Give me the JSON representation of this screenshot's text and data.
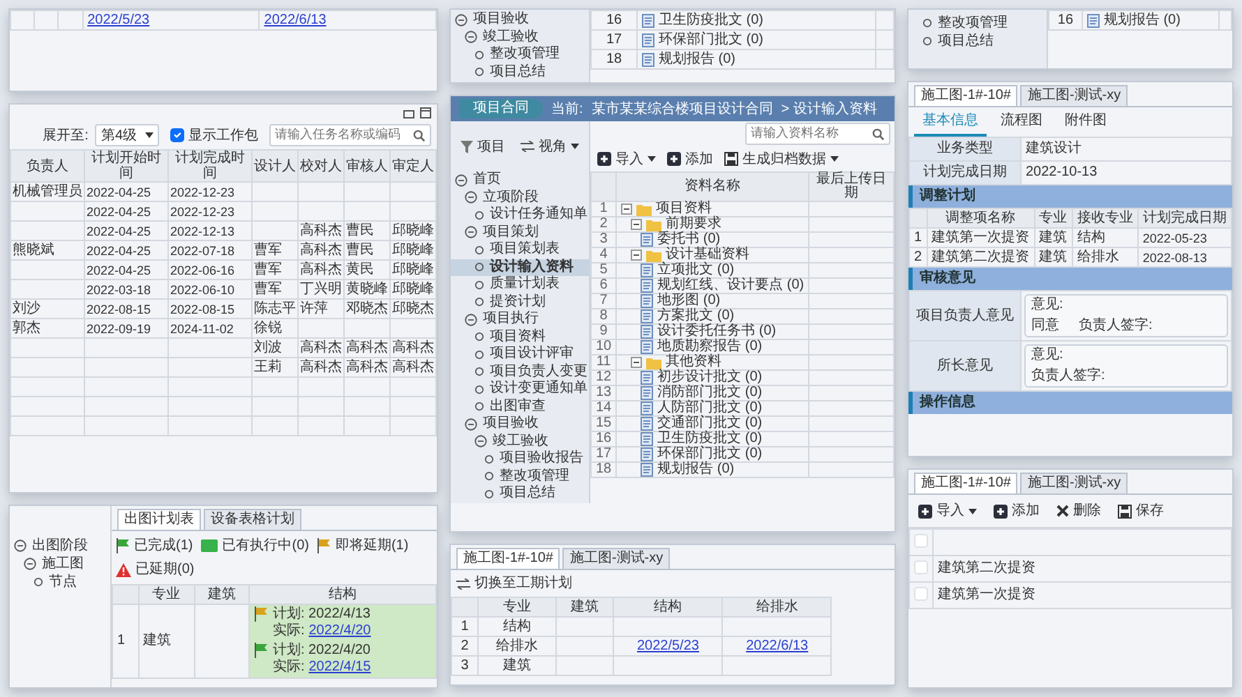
{
  "top_left_fragment": {
    "rows": [
      {
        "cells": [
          {
            "text": "2022/5/23",
            "link": true
          },
          {
            "text": "2022/6/13",
            "link": true
          }
        ]
      }
    ]
  },
  "top_middle_fragment": {
    "nav": [
      {
        "label": "项目验收",
        "expanded": true,
        "children": [
          {
            "label": "竣工验收",
            "expanded": true,
            "children": [
              {
                "label": "整改项管理"
              },
              {
                "label": "项目总结"
              }
            ]
          }
        ]
      }
    ],
    "rows": [
      {
        "no": "16",
        "label": "卫生防疫批文 (0)"
      },
      {
        "no": "17",
        "label": "环保部门批文 (0)"
      },
      {
        "no": "18",
        "label": "规划报告 (0)"
      }
    ]
  },
  "top_right_fragment": {
    "nav": [
      {
        "label": "整改项管理"
      },
      {
        "label": "项目总结"
      }
    ],
    "rows": [
      {
        "no": "16",
        "label": "规划报告 (0)"
      }
    ]
  },
  "schedule_panel": {
    "expand_label": "展开至:",
    "expand_level": "第4级",
    "show_packages": {
      "label": "显示工作包",
      "checked": true
    },
    "search": {
      "placeholder": "请输入任务名称或编码"
    },
    "columns": [
      "负责人",
      "计划开始时间",
      "计划完成时间",
      "设计人",
      "校对人",
      "审核人",
      "审定人"
    ],
    "rows": [
      {
        "cells": [
          "机械管理员",
          "2022-04-25",
          "2022-12-23",
          "",
          "",
          "",
          ""
        ]
      },
      {
        "cells": [
          "",
          "2022-04-25",
          "2022-12-23",
          "",
          "",
          "",
          ""
        ]
      },
      {
        "cells": [
          "",
          "2022-04-25",
          "2022-12-13",
          "",
          "高科杰",
          "曹民",
          "邱晓峰"
        ]
      },
      {
        "cells": [
          "熊晓斌",
          "2022-04-25",
          "2022-07-18",
          "曹军",
          "高科杰",
          "曹民",
          "邱晓峰"
        ]
      },
      {
        "cells": [
          "",
          "2022-04-25",
          "2022-06-16",
          "曹军",
          "高科杰",
          "黄民",
          "邱晓峰"
        ]
      },
      {
        "cells": [
          "",
          "2022-03-18",
          "2022-06-10",
          "曹军",
          "丁兴明",
          "黄晓峰",
          "邱晓峰"
        ]
      },
      {
        "cells": [
          "刘沙",
          "2022-08-15",
          "2022-08-15",
          "陈志平",
          "许萍",
          "邓晓杰",
          "邱晓杰"
        ]
      },
      {
        "cells": [
          "郭杰",
          "2022-09-19",
          "2024-11-02",
          "徐锐",
          "",
          "",
          ""
        ]
      },
      {
        "cells": [
          "",
          "",
          "",
          "刘波",
          "高科杰",
          "高科杰",
          "高科杰"
        ]
      },
      {
        "cells": [
          "",
          "",
          "",
          "王莉",
          "高科杰",
          "高科杰",
          "高科杰"
        ]
      }
    ]
  },
  "main_panel": {
    "module_tab": "项目合同",
    "breadcrumb_label": "当前:",
    "breadcrumb": "某市某某综合楼项目设计合同",
    "breadcrumb_current": "> 设计输入资料",
    "search": {
      "placeholder": "请输入资料名称"
    },
    "nav_header": {
      "title": "项目",
      "view": "视角"
    },
    "nav": [
      {
        "label": "首页",
        "expanded": true,
        "selected": false,
        "children": [
          {
            "label": "立项阶段",
            "expanded": true,
            "selected": false,
            "children": [
              {
                "label": "设计任务通知单",
                "selected": false
              }
            ]
          },
          {
            "label": "项目策划",
            "expanded": true,
            "selected": false,
            "children": [
              {
                "label": "项目策划表",
                "selected": false
              },
              {
                "label": "设计输入资料",
                "selected": true
              },
              {
                "label": "质量计划表",
                "selected": false
              },
              {
                "label": "提资计划",
                "selected": false
              }
            ]
          },
          {
            "label": "项目执行",
            "expanded": true,
            "selected": false,
            "children": [
              {
                "label": "项目资料",
                "selected": false
              },
              {
                "label": "项目设计评审",
                "selected": false
              },
              {
                "label": "项目负责人变更",
                "selected": false
              },
              {
                "label": "设计变更通知单",
                "selected": false
              },
              {
                "label": "出图审查",
                "selected": false
              }
            ]
          },
          {
            "label": "项目验收",
            "expanded": true,
            "selected": false,
            "children": [
              {
                "label": "竣工验收",
                "expanded": true,
                "selected": false,
                "children": [
                  {
                    "label": "项目验收报告",
                    "selected": false
                  },
                  {
                    "label": "整改项管理",
                    "selected": false
                  },
                  {
                    "label": "项目总结",
                    "selected": false
                  }
                ]
              }
            ]
          }
        ]
      }
    ],
    "toolbar": [
      {
        "label": "导入",
        "kind": "import"
      },
      {
        "label": "添加",
        "kind": "add"
      },
      {
        "label": "生成归档数据",
        "kind": "archive"
      }
    ],
    "columns": [
      "资料名称",
      "最后上传日期"
    ],
    "resources": [
      {
        "no": "1",
        "label": "项目资料",
        "expanded": true,
        "children": [
          {
            "no": "2",
            "label": "前期要求",
            "expanded": true,
            "children": [
              {
                "no": "3",
                "label": "委托书 (0)"
              }
            ]
          },
          {
            "no": "4",
            "label": "设计基础资料",
            "expanded": true,
            "children": [
              {
                "no": "5",
                "label": "立项批文 (0)"
              },
              {
                "no": "6",
                "label": "规划红线、设计要点 (0)"
              },
              {
                "no": "7",
                "label": "地形图 (0)"
              },
              {
                "no": "8",
                "label": "方案批文 (0)"
              },
              {
                "no": "9",
                "label": "设计委托任务书 (0)"
              },
              {
                "no": "10",
                "label": "地质勘察报告 (0)"
              }
            ]
          },
          {
            "no": "11",
            "label": "其他资料",
            "expanded": true,
            "children": [
              {
                "no": "12",
                "label": "初步设计批文 (0)"
              },
              {
                "no": "13",
                "label": "消防部门批文 (0)"
              },
              {
                "no": "14",
                "label": "人防部门批文 (0)"
              },
              {
                "no": "15",
                "label": "交通部门批文 (0)"
              },
              {
                "no": "16",
                "label": "卫生防疫批文 (0)"
              },
              {
                "no": "17",
                "label": "环保部门批文 (0)"
              },
              {
                "no": "18",
                "label": "规划报告 (0)"
              }
            ]
          }
        ]
      }
    ]
  },
  "detail_panel": {
    "doc_tabs": [
      {
        "label": "施工图-1#-10#",
        "selected": true
      },
      {
        "label": "施工图-测试-xy",
        "selected": false
      }
    ],
    "view_tabs": [
      {
        "label": "基本信息",
        "selected": true
      },
      {
        "label": "流程图",
        "selected": false
      },
      {
        "label": "附件图",
        "selected": false
      }
    ],
    "fields": [
      {
        "label": "业务类型",
        "value": "建筑设计"
      },
      {
        "label": "计划完成日期",
        "value": "2022-10-13"
      }
    ],
    "plan_section": {
      "title": "调整计划",
      "columns": [
        "调整项名称",
        "专业",
        "接收专业",
        "计划完成日期"
      ],
      "rows": [
        {
          "no": "1",
          "cells": [
            "建筑第一次提资",
            "建筑",
            "结构",
            "2022-05-23"
          ]
        },
        {
          "no": "2",
          "cells": [
            "建筑第二次提资",
            "建筑",
            "给排水",
            "2022-08-13"
          ]
        }
      ]
    },
    "review_section": {
      "title": "审核意见",
      "opinions": [
        {
          "label": "项目负责人意见",
          "opinion_label": "意见:",
          "opinion": "同意",
          "signature_label": "负责人签字:"
        },
        {
          "label": "所长意见",
          "opinion_label": "意见:",
          "signature_label": "负责人签字:"
        }
      ]
    },
    "ops_section": {
      "title": "操作信息"
    }
  },
  "drawing_plan_panel": {
    "tabs": [
      {
        "label": "出图计划表",
        "selected": true
      },
      {
        "label": "设备表格计划",
        "selected": false
      }
    ],
    "legend": [
      {
        "label": "已完成(1)",
        "kind": "flag",
        "color": "#3aa53a"
      },
      {
        "label": "已有执行中(0)",
        "kind": "bar",
        "color": "#38b24a"
      },
      {
        "label": "即将延期(1)",
        "kind": "flag",
        "color": "#d9a21b"
      },
      {
        "label": "已延期(0)",
        "kind": "warning",
        "color": "#e03030"
      }
    ],
    "tree": [
      {
        "label": "出图阶段",
        "expanded": true,
        "children": [
          {
            "label": "施工图",
            "expanded": true,
            "children": [
              {
                "label": "节点"
              }
            ]
          }
        ]
      }
    ],
    "columns": [
      "专业",
      "建筑",
      "结构"
    ],
    "rows": [
      {
        "no": "1",
        "discipline": "建筑",
        "entries": [
          {
            "plan": "计划: 2022/4/13",
            "actual_label": "实际:",
            "actual": "2022/4/20",
            "color": "#d9a21b"
          },
          {
            "plan": "计划: 2022/4/20",
            "actual_label": "实际:",
            "actual": "2022/4/15",
            "color": "#3aa53a"
          }
        ]
      }
    ]
  },
  "schedule_grid_panel": {
    "tabs": [
      {
        "label": "施工图-1#-10#",
        "selected": true
      },
      {
        "label": "施工图-测试-xy",
        "selected": false
      }
    ],
    "action": "切换至工期计划",
    "columns": [
      "专业",
      "建筑",
      "结构",
      "给排水"
    ],
    "rows": [
      {
        "no": "1",
        "cells": [
          {
            "text": "结构"
          },
          {
            "text": ""
          },
          {
            "text": ""
          },
          {
            "text": ""
          }
        ]
      },
      {
        "no": "2",
        "cells": [
          {
            "text": "给排水"
          },
          {
            "text": ""
          },
          {
            "text": "2022/5/23",
            "link": true
          },
          {
            "text": "2022/6/13",
            "link": true
          }
        ]
      },
      {
        "no": "3",
        "cells": [
          {
            "text": "建筑"
          },
          {
            "text": ""
          },
          {
            "text": ""
          },
          {
            "text": ""
          }
        ]
      }
    ]
  },
  "item_list_panel": {
    "tabs": [
      {
        "label": "施工图-1#-10#",
        "selected": true
      },
      {
        "label": "施工图-测试-xy",
        "selected": false
      }
    ],
    "toolbar": [
      {
        "label": "导入",
        "kind": "import"
      },
      {
        "label": "添加",
        "kind": "add"
      },
      {
        "label": "删除",
        "kind": "delete"
      },
      {
        "label": "保存",
        "kind": "save"
      }
    ],
    "rows": [
      {
        "checked": false
      },
      {
        "label": "建筑第二次提资",
        "checked": false
      },
      {
        "label": "建筑第一次提资",
        "checked": false
      }
    ]
  }
}
